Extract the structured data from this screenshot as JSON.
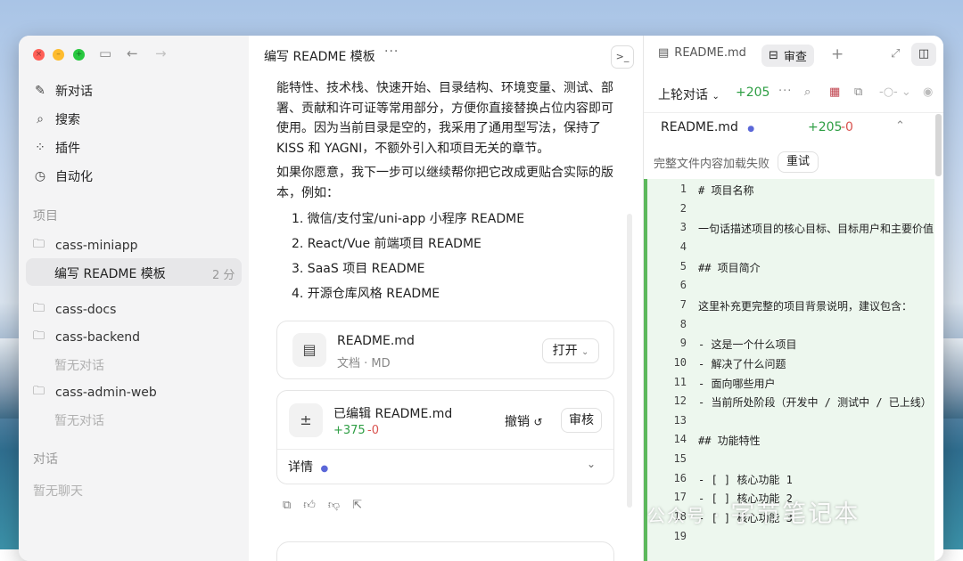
{
  "sidebar": {
    "nav": [
      {
        "label": "新对话",
        "icon": "new-chat-icon"
      },
      {
        "label": "搜索",
        "icon": "search-icon"
      },
      {
        "label": "插件",
        "icon": "plugins-icon"
      },
      {
        "label": "自动化",
        "icon": "clock-icon"
      }
    ],
    "projects_title": "项目",
    "projects": [
      {
        "name": "cass-miniapp"
      },
      {
        "name": "cass-docs"
      },
      {
        "name": "cass-backend",
        "empty": "暂无对话"
      },
      {
        "name": "cass-admin-web",
        "empty": "暂无对话"
      }
    ],
    "active_thread": {
      "label": "编写 README 模板",
      "time": "2 分"
    },
    "chats_title": "对话",
    "chats_empty": "暂无聊天"
  },
  "middle": {
    "title": "编写 README 模板",
    "para1": "能特性、技术栈、快速开始、目录结构、环境变量、测试、部署、贡献和许可证等常用部分，方便你直接替换占位内容即可使用。因为当前目录是空的，我采用了通用型写法，保持了 KISS 和 YAGNI，不额外引入和项目无关的章节。",
    "para2": "如果你愿意，我下一步可以继续帮你把它改成更贴合实际的版本，例如：",
    "list": [
      "1. 微信/支付宝/uni-app 小程序 README",
      "2. React/Vue 前端项目 README",
      "3. SaaS 项目 README",
      "4. 开源仓库风格 README"
    ],
    "file_card": {
      "name": "README.md",
      "meta": "文档 · MD",
      "open_label": "打开"
    },
    "edit_card": {
      "title": "已编辑 README.md",
      "added": "+375",
      "removed": "-0",
      "undo_label": "撤销",
      "review_label": "审核",
      "details_label": "详情"
    }
  },
  "right": {
    "tab_file": "README.md",
    "tab_review": "审查",
    "scope_label": "上轮对话",
    "scope_added": "+205",
    "file_name": "README.md",
    "file_added": "+205",
    "file_removed": "-0",
    "error_text": "完整文件内容加载失败",
    "retry_label": "重试",
    "lines": [
      {
        "n": "1",
        "t": "# 项目名称"
      },
      {
        "n": "2",
        "t": ""
      },
      {
        "n": "3",
        "t": "一句话描述项目的核心目标、目标用户和主要价值"
      },
      {
        "n": "4",
        "t": ""
      },
      {
        "n": "5",
        "t": "## 项目简介"
      },
      {
        "n": "6",
        "t": ""
      },
      {
        "n": "7",
        "t": "这里补充更完整的项目背景说明，建议包含："
      },
      {
        "n": "8",
        "t": ""
      },
      {
        "n": "9",
        "t": "- 这是一个什么项目"
      },
      {
        "n": "10",
        "t": "- 解决了什么问题"
      },
      {
        "n": "11",
        "t": "- 面向哪些用户"
      },
      {
        "n": "12",
        "t": "- 当前所处阶段（开发中 / 测试中 / 已上线）"
      },
      {
        "n": "13",
        "t": ""
      },
      {
        "n": "14",
        "t": "## 功能特性"
      },
      {
        "n": "15",
        "t": ""
      },
      {
        "n": "16",
        "t": "- [ ] 核心功能 1"
      },
      {
        "n": "17",
        "t": "- [ ] 核心功能 2"
      },
      {
        "n": "18",
        "t": "- [ ] 核心功能 3"
      },
      {
        "n": "19",
        "t": ""
      }
    ]
  },
  "watermark": {
    "text": "字节笔记本",
    "prefix": "公众号 ·"
  },
  "colors": {
    "added": "#2e9e44",
    "removed": "#d9534f",
    "accent_dot": "#5b67d8"
  }
}
